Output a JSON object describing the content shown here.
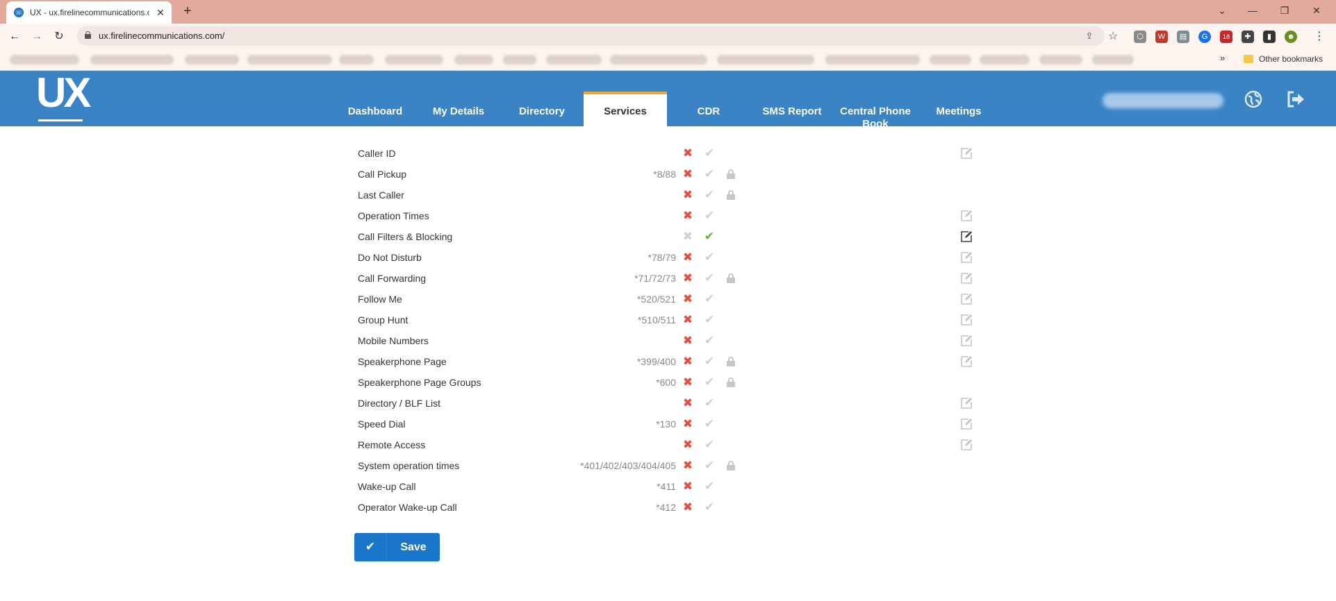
{
  "browser": {
    "tab_title": "UX - ux.firelinecommunications.c",
    "tab_close": "✕",
    "new_tab": "+",
    "url": "ux.firelinecommunications.com/",
    "other_bookmarks": "Other bookmarks",
    "extension_badge": "18"
  },
  "app": {
    "logo": "UX",
    "nav": [
      {
        "label": "Dashboard",
        "active": false
      },
      {
        "label": "My Details",
        "active": false
      },
      {
        "label": "Directory",
        "active": false
      },
      {
        "label": "Services",
        "active": true
      },
      {
        "label": "CDR",
        "active": false
      },
      {
        "label": "SMS Report",
        "active": false
      },
      {
        "label": "Central Phone Book",
        "active": false
      },
      {
        "label": "Meetings",
        "active": false
      }
    ]
  },
  "services": [
    {
      "name": "Caller ID",
      "code": "",
      "enabled": false,
      "locked": false,
      "editable": true
    },
    {
      "name": "Call Pickup",
      "code": "*8/88",
      "enabled": false,
      "locked": true,
      "editable": false
    },
    {
      "name": "Last Caller",
      "code": "",
      "enabled": false,
      "locked": true,
      "editable": false
    },
    {
      "name": "Operation Times",
      "code": "",
      "enabled": false,
      "locked": false,
      "editable": true
    },
    {
      "name": "Call Filters & Blocking",
      "code": "",
      "enabled": true,
      "locked": false,
      "editable": true
    },
    {
      "name": "Do Not Disturb",
      "code": "*78/79",
      "enabled": false,
      "locked": false,
      "editable": true
    },
    {
      "name": "Call Forwarding",
      "code": "*71/72/73",
      "enabled": false,
      "locked": true,
      "editable": true
    },
    {
      "name": "Follow Me",
      "code": "*520/521",
      "enabled": false,
      "locked": false,
      "editable": true
    },
    {
      "name": "Group Hunt",
      "code": "*510/511",
      "enabled": false,
      "locked": false,
      "editable": true
    },
    {
      "name": "Mobile Numbers",
      "code": "",
      "enabled": false,
      "locked": false,
      "editable": true
    },
    {
      "name": "Speakerphone Page",
      "code": "*399/400",
      "enabled": false,
      "locked": true,
      "editable": true
    },
    {
      "name": "Speakerphone Page Groups",
      "code": "*600",
      "enabled": false,
      "locked": true,
      "editable": false
    },
    {
      "name": "Directory / BLF List",
      "code": "",
      "enabled": false,
      "locked": false,
      "editable": true
    },
    {
      "name": "Speed Dial",
      "code": "*130",
      "enabled": false,
      "locked": false,
      "editable": true
    },
    {
      "name": "Remote Access",
      "code": "",
      "enabled": false,
      "locked": false,
      "editable": true
    },
    {
      "name": "System operation times",
      "code": "*401/402/403/404/405",
      "enabled": false,
      "locked": true,
      "editable": false
    },
    {
      "name": "Wake-up Call",
      "code": "*411",
      "enabled": false,
      "locked": false,
      "editable": false
    },
    {
      "name": "Operator Wake-up Call",
      "code": "*412",
      "enabled": false,
      "locked": false,
      "editable": false
    }
  ],
  "save_label": "Save",
  "colors": {
    "header_blue": "#3a83c4",
    "active_tab_accent": "#f0a43a",
    "off_red": "#e74c3c",
    "on_green": "#5cb82e",
    "inactive_gray": "#cfcfcf",
    "save_blue": "#1a76c9"
  },
  "icons": {
    "off": "cross-icon",
    "on": "check-icon",
    "lock": "lock-icon",
    "edit": "edit-icon",
    "globe": "globe-icon",
    "logout": "logout-icon"
  }
}
